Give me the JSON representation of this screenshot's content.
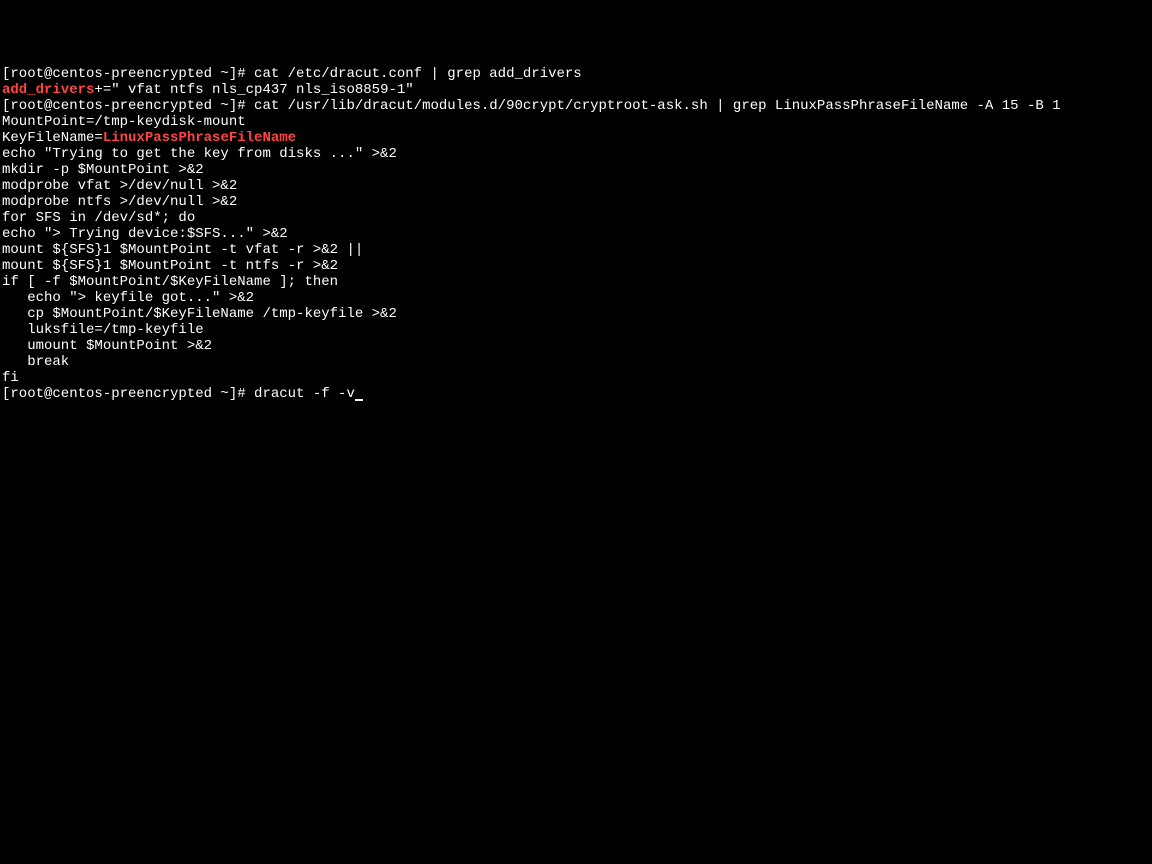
{
  "lines": [
    {
      "segments": [
        {
          "t": "[root@centos-preencrypted ~]# cat /etc/dracut.conf | grep add_drivers"
        }
      ]
    },
    {
      "segments": [
        {
          "t": "add_drivers",
          "hl": true
        },
        {
          "t": "+=\" vfat ntfs nls_cp437 nls_iso8859-1\""
        }
      ]
    },
    {
      "segments": [
        {
          "t": "[root@centos-preencrypted ~]# cat /usr/lib/dracut/modules.d/90crypt/cryptroot-ask.sh | grep LinuxPassPhraseFileName -A 15 -B 1"
        }
      ]
    },
    {
      "segments": [
        {
          "t": "MountPoint=/tmp-keydisk-mount"
        }
      ]
    },
    {
      "segments": [
        {
          "t": "KeyFileName="
        },
        {
          "t": "LinuxPassPhraseFileName",
          "hl": true
        }
      ]
    },
    {
      "segments": [
        {
          "t": "echo \"Trying to get the key from disks ...\" >&2"
        }
      ]
    },
    {
      "segments": [
        {
          "t": "mkdir -p $MountPoint >&2"
        }
      ]
    },
    {
      "segments": [
        {
          "t": "modprobe vfat >/dev/null >&2"
        }
      ]
    },
    {
      "segments": [
        {
          "t": "modprobe ntfs >/dev/null >&2"
        }
      ]
    },
    {
      "segments": [
        {
          "t": "for SFS in /dev/sd*; do"
        }
      ]
    },
    {
      "segments": [
        {
          "t": "echo \"> Trying device:$SFS...\" >&2"
        }
      ]
    },
    {
      "segments": [
        {
          "t": "mount ${SFS}1 $MountPoint -t vfat -r >&2 ||"
        }
      ]
    },
    {
      "segments": [
        {
          "t": "mount ${SFS}1 $MountPoint -t ntfs -r >&2"
        }
      ]
    },
    {
      "segments": [
        {
          "t": "if [ -f $MountPoint/$KeyFileName ]; then"
        }
      ]
    },
    {
      "segments": [
        {
          "t": "   echo \"> keyfile got...\" >&2"
        }
      ]
    },
    {
      "segments": [
        {
          "t": "   cp $MountPoint/$KeyFileName /tmp-keyfile >&2"
        }
      ]
    },
    {
      "segments": [
        {
          "t": "   luksfile=/tmp-keyfile"
        }
      ]
    },
    {
      "segments": [
        {
          "t": "   umount $MountPoint >&2"
        }
      ]
    },
    {
      "segments": [
        {
          "t": "   break"
        }
      ]
    },
    {
      "segments": [
        {
          "t": "fi"
        }
      ]
    },
    {
      "segments": [
        {
          "t": "[root@centos-preencrypted ~]# dracut -f -v"
        }
      ],
      "cursor": true
    }
  ]
}
